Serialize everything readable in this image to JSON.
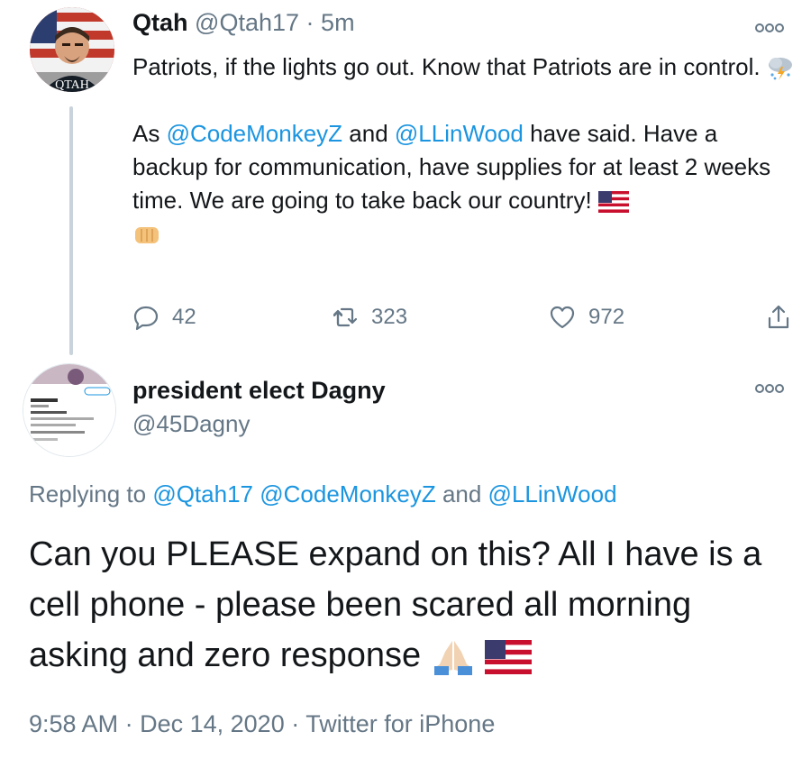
{
  "tweet1": {
    "author_name": "Qtah",
    "author_handle": "@Qtah17",
    "separator": "·",
    "time_ago": "5m",
    "avatar_text": "QTAH",
    "text_line1": "Patriots, if the lights go out. Know that Patriots are in control.",
    "text_p2_start": "As ",
    "mention1": "@CodeMonkeyZ",
    "text_p2_and": " and ",
    "mention2": "@LLinWood",
    "text_p2_end": " have said. Have a backup for communication, have supplies for at least 2 weeks time. We are going to take back our country!",
    "reply_count": "42",
    "retweet_count": "323",
    "like_count": "972",
    "icons": [
      "thunderstorm-emoji",
      "us-flag-emoji",
      "fist-bump-emoji",
      "reply-icon",
      "retweet-icon",
      "like-icon",
      "share-icon",
      "more-icon"
    ]
  },
  "tweet2": {
    "author_name": "president elect Dagny",
    "author_handle": "@45Dagny",
    "replying_prefix": "Replying to ",
    "reply_mention1": "@Qtah17",
    "reply_space": " ",
    "reply_mention2": "@CodeMonkeyZ",
    "reply_and": " and ",
    "reply_mention3": "@LLinWood",
    "text": "Can you PLEASE expand on this? All I have is a cell phone - please been scared all morning asking and zero response",
    "time": "9:58 AM",
    "dot": "·",
    "date": "Dec 14, 2020",
    "source": "Twitter for iPhone",
    "icons": [
      "folded-hands-emoji",
      "us-flag-emoji",
      "more-icon"
    ]
  },
  "colors": {
    "link": "#1b95e0",
    "secondary_text": "#657786",
    "thread_line": "#c9d3db"
  }
}
